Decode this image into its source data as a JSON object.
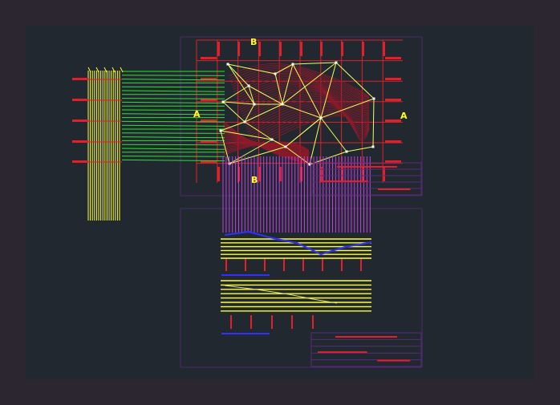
{
  "colors": {
    "window_bg": "#2b2630",
    "model_space": "#212830",
    "grid_red": "#e0202a",
    "contour_dark_red": "#8e1a2a",
    "triangulation_yellow": "#f0ff60",
    "projection_green": "#30e030",
    "section_yellow": "#ffff3a",
    "section_magenta": "#c040e0",
    "frame_purple": "#5a2a78",
    "label_yellow": "#ffff20",
    "profile_blue": "#3030ff"
  },
  "section_markers": {
    "top": "B",
    "bottom": "B",
    "left": "A",
    "right": "A"
  }
}
